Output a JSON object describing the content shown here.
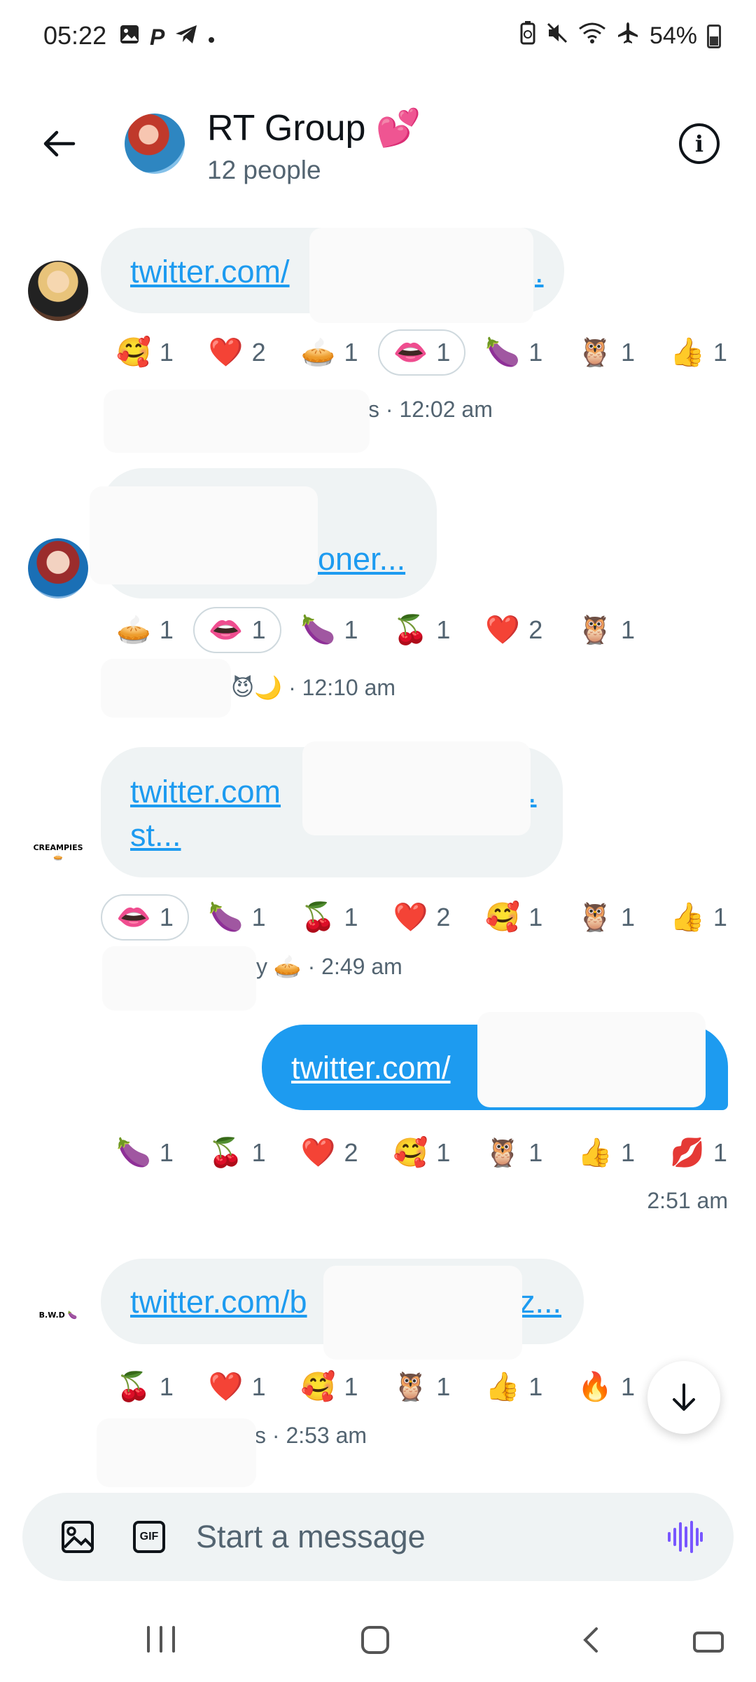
{
  "status_bar": {
    "time": "05:22",
    "battery": "54%",
    "left_icons": [
      "gallery-icon",
      "paypal-icon",
      "telegram-icon",
      "dot"
    ],
    "right_icons": [
      "battery-saver-icon",
      "mute-icon",
      "wifi-icon",
      "airplane-icon"
    ]
  },
  "header": {
    "title": "RT Group 💕",
    "subtitle": "12 people"
  },
  "messages": [
    {
      "link": "twitter.com/",
      "tail": ".",
      "reactions": [
        {
          "emoji": "🥰",
          "count": "1"
        },
        {
          "emoji": "❤️",
          "count": "2"
        },
        {
          "emoji": "🥧",
          "count": "1"
        },
        {
          "emoji": "👄",
          "count": "1"
        },
        {
          "emoji": "🍆",
          "count": "1"
        },
        {
          "emoji": "🦉",
          "count": "1"
        },
        {
          "emoji": "👍",
          "count": "1"
        }
      ],
      "meta": "s · 12:02 am"
    },
    {
      "link": "oner...",
      "reactions": [
        {
          "emoji": "🥧",
          "count": "1"
        },
        {
          "emoji": "👄",
          "count": "1"
        },
        {
          "emoji": "🍆",
          "count": "1"
        },
        {
          "emoji": "🍒",
          "count": "1"
        },
        {
          "emoji": "❤️",
          "count": "2"
        },
        {
          "emoji": "🦉",
          "count": "1"
        }
      ],
      "meta": "😈🌙 · 12:10 am"
    },
    {
      "avatar_label": "CREAMPIES 🥧",
      "link_line1": "twitter.com",
      "link_line2": "st...",
      "tail": ".",
      "reactions": [
        {
          "emoji": "👄",
          "count": "1"
        },
        {
          "emoji": "🍆",
          "count": "1"
        },
        {
          "emoji": "🍒",
          "count": "1"
        },
        {
          "emoji": "❤️",
          "count": "2"
        },
        {
          "emoji": "🥰",
          "count": "1"
        },
        {
          "emoji": "🦉",
          "count": "1"
        },
        {
          "emoji": "👍",
          "count": "1"
        }
      ],
      "meta": "y 🥧 · 2:49 am"
    },
    {
      "link": "twitter.com/",
      "reactions": [
        {
          "emoji": "🍆",
          "count": "1"
        },
        {
          "emoji": "🍒",
          "count": "1"
        },
        {
          "emoji": "❤️",
          "count": "2"
        },
        {
          "emoji": "🥰",
          "count": "1"
        },
        {
          "emoji": "🦉",
          "count": "1"
        },
        {
          "emoji": "👍",
          "count": "1"
        },
        {
          "emoji": "💋",
          "count": "1"
        }
      ],
      "meta": "2:51 am"
    },
    {
      "avatar_label": "B.W.D 🍆",
      "link": "twitter.com/b",
      "tail": "z...",
      "reactions": [
        {
          "emoji": "🍒",
          "count": "1"
        },
        {
          "emoji": "❤️",
          "count": "1"
        },
        {
          "emoji": "🥰",
          "count": "1"
        },
        {
          "emoji": "🦉",
          "count": "1"
        },
        {
          "emoji": "👍",
          "count": "1"
        },
        {
          "emoji": "🔥",
          "count": "1"
        }
      ],
      "meta": "s · 2:53 am"
    }
  ],
  "composer": {
    "placeholder": "Start a message",
    "gif_label": "GIF"
  },
  "colors": {
    "accent": "#1d9bf0",
    "bubble_in": "#eff3f4",
    "muted": "#536471",
    "voice": "#7856ff"
  }
}
